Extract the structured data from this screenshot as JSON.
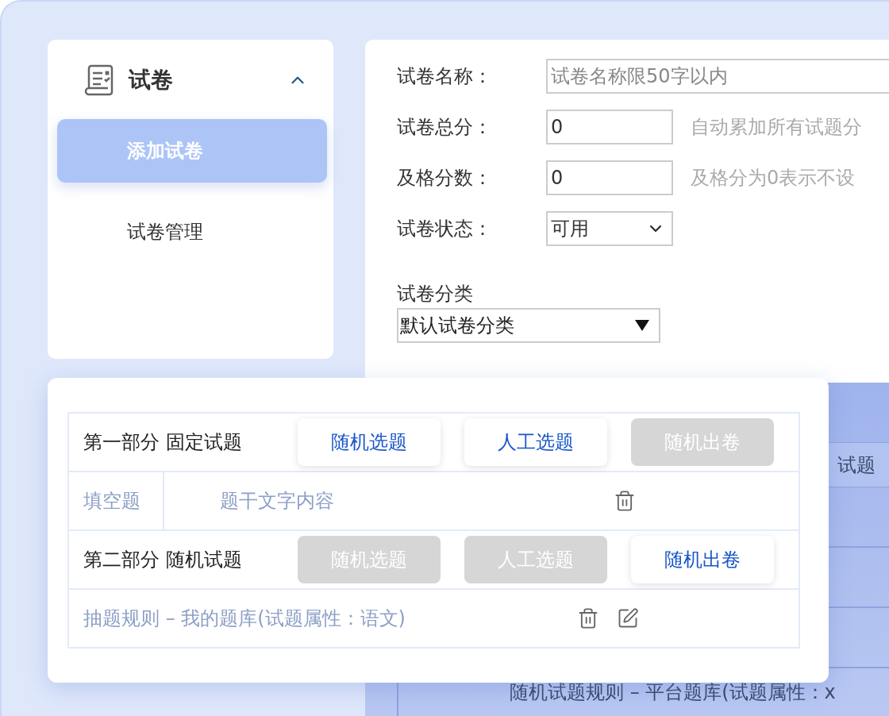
{
  "sidebar": {
    "group": {
      "title": "试卷",
      "expanded": true
    },
    "items": [
      {
        "label": "添加试卷",
        "selected": true
      },
      {
        "label": "试卷管理",
        "selected": false
      }
    ]
  },
  "form": {
    "fields": [
      {
        "kind": "text",
        "wide": true,
        "label": "试卷名称：",
        "placeholder": "试卷名称限50字以内"
      },
      {
        "kind": "text",
        "label": "试卷总分：",
        "value": "0",
        "hint": "自动累加所有试题分"
      },
      {
        "kind": "text",
        "label": "及格分数：",
        "value": "0",
        "hint": "及格分为0表示不设"
      },
      {
        "kind": "select",
        "label": "试卷状态：",
        "value": "可用"
      }
    ],
    "category": {
      "label": "试卷分类",
      "value": "默认试卷分类"
    }
  },
  "background_table": {
    "header_cell": "试题",
    "footer_text": "随机试题规则 – 平台题库(试题属性：x"
  },
  "paper_sections": [
    {
      "title": "第一部分 固定试题",
      "buttons": [
        {
          "label": "随机选题",
          "disabled": false
        },
        {
          "label": "人工选题",
          "disabled": false
        },
        {
          "label": "随机出卷",
          "disabled": true
        }
      ],
      "rows": [
        {
          "kind": "question",
          "type": "填空题",
          "text": "题干文字内容"
        }
      ]
    },
    {
      "title": "第二部分 随机试题",
      "buttons": [
        {
          "label": "随机选题",
          "disabled": true
        },
        {
          "label": "人工选题",
          "disabled": true
        },
        {
          "label": "随机出卷",
          "disabled": false
        }
      ],
      "rows": [
        {
          "kind": "rule",
          "text": "抽题规则 –  我的题库(试题属性：语文)"
        }
      ]
    }
  ]
}
